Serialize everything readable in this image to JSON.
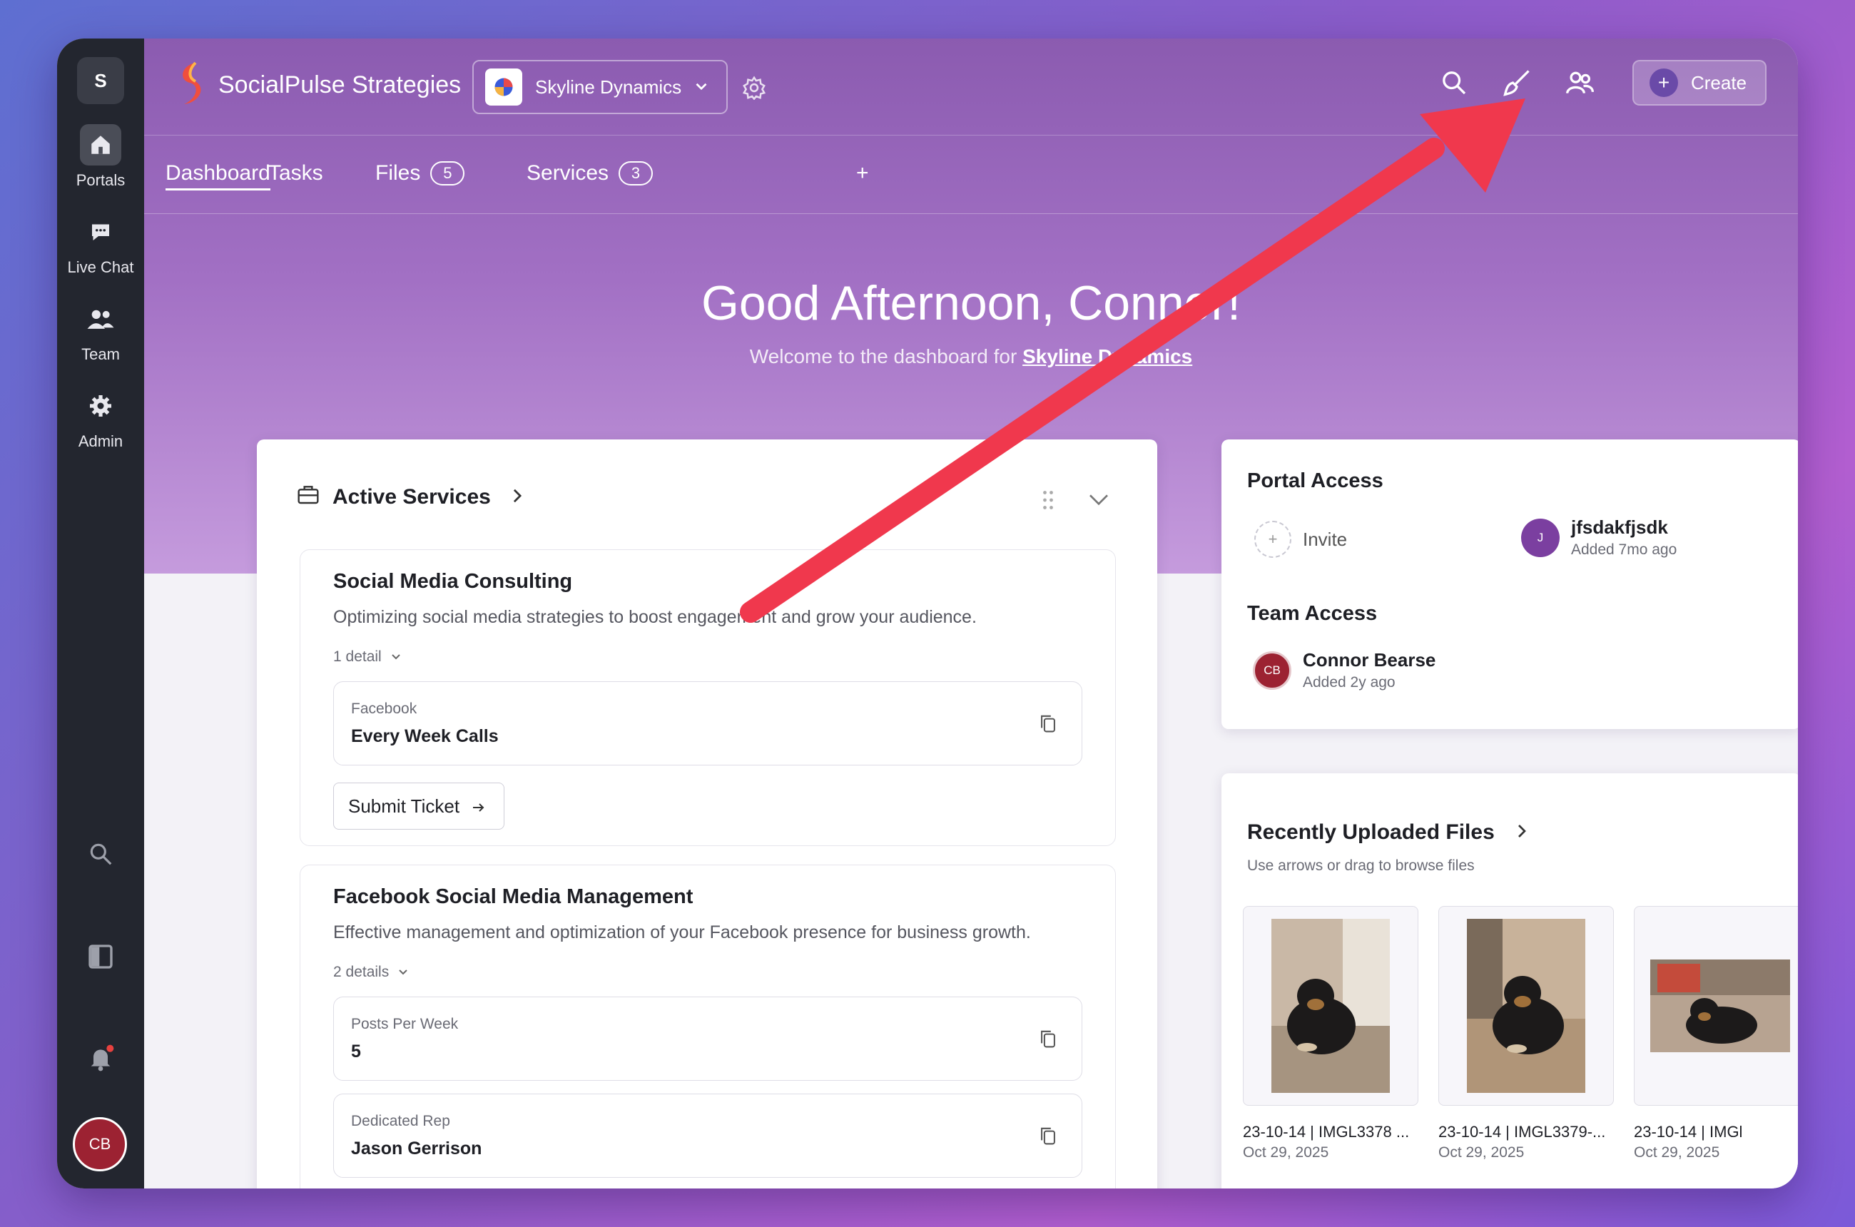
{
  "rail": {
    "workspace_initial": "S",
    "items": [
      {
        "label": "Portals",
        "icon": "home-icon"
      },
      {
        "label": "Live Chat",
        "icon": "chat-icon"
      },
      {
        "label": "Team",
        "icon": "team-icon"
      },
      {
        "label": "Admin",
        "icon": "gear-icon"
      }
    ],
    "user_initials": "CB"
  },
  "header": {
    "brand": "SocialPulse Strategies",
    "workspace": "Skyline Dynamics",
    "create_label": "Create"
  },
  "tabs": [
    {
      "label": "Dashboard",
      "active": true
    },
    {
      "label": "Tasks"
    },
    {
      "label": "Files",
      "count": "5"
    },
    {
      "label": "Services",
      "count": "3"
    },
    {
      "label": "+"
    }
  ],
  "hero": {
    "greeting": "Good Afternoon, Connor!",
    "welcome_prefix": "Welcome to the dashboard for ",
    "welcome_link": "Skyline Dynamics"
  },
  "services": {
    "title": "Active Services",
    "items": [
      {
        "title": "Social Media Consulting",
        "description": "Optimizing social media strategies to boost engagement and grow your audience.",
        "details_label": "1 detail",
        "fields": [
          {
            "label": "Facebook",
            "value": "Every Week Calls"
          }
        ],
        "action": "Submit Ticket"
      },
      {
        "title": "Facebook Social Media Management",
        "description": "Effective management and optimization of your Facebook presence for business growth.",
        "details_label": "2 details",
        "fields": [
          {
            "label": "Posts Per Week",
            "value": "5"
          },
          {
            "label": "Dedicated Rep",
            "value": "Jason Gerrison"
          }
        ]
      }
    ]
  },
  "portal_access": {
    "title": "Portal Access",
    "invite_label": "Invite",
    "invite_icon": "+",
    "member": {
      "initial": "J",
      "name": "jfsdakfjsdk",
      "added": "Added 7mo ago"
    }
  },
  "team_access": {
    "title": "Team Access",
    "member": {
      "initials": "CB",
      "name": "Connor Bearse",
      "added": "Added 2y ago"
    }
  },
  "files": {
    "title": "Recently Uploaded Files",
    "subtitle": "Use arrows or drag to browse files",
    "items": [
      {
        "name": "23-10-14 | IMGL3378 ...",
        "date": "Oct 29, 2025"
      },
      {
        "name": "23-10-14 | IMGL3379-...",
        "date": "Oct 29, 2025"
      },
      {
        "name": "23-10-14 | IMGl",
        "date": "Oct 29, 2025"
      }
    ]
  },
  "colors": {
    "rail": "#23262f",
    "hero": "#9a67bf",
    "annotation_arrow": "#f0384d",
    "avatar_cb": "#9c2232",
    "avatar_j": "#7b3fa0"
  }
}
